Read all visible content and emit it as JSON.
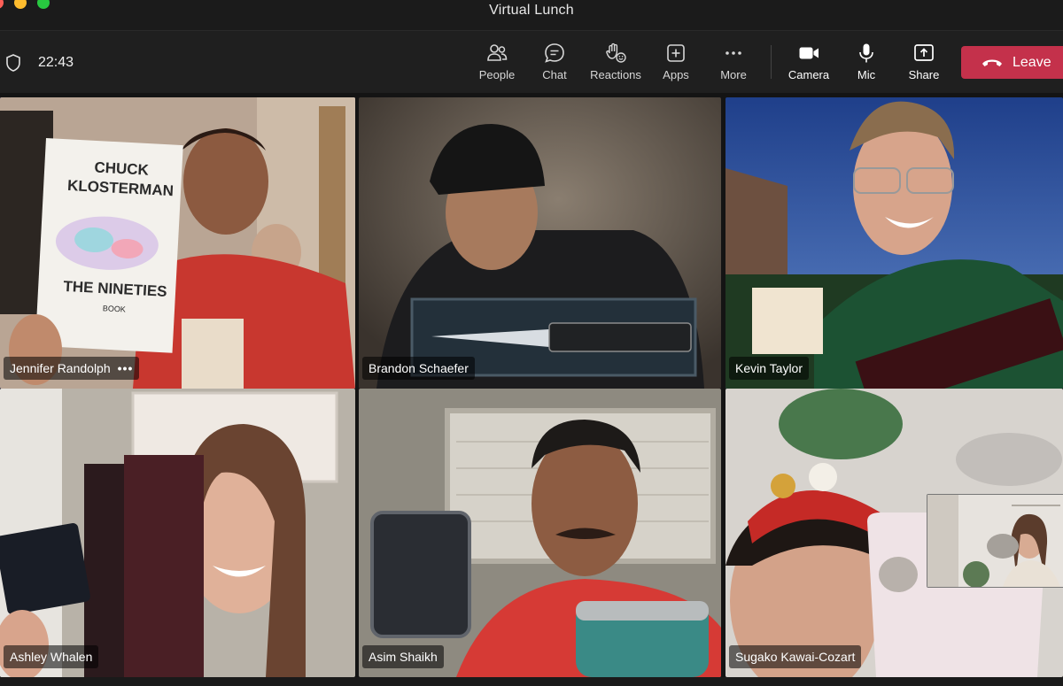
{
  "window": {
    "title": "Virtual Lunch"
  },
  "toolbar": {
    "timer": "22:43",
    "buttons": {
      "people": "People",
      "chat": "Chat",
      "reactions": "Reactions",
      "apps": "Apps",
      "more": "More",
      "camera": "Camera",
      "mic": "Mic",
      "share": "Share"
    },
    "leave": "Leave"
  },
  "participants": [
    {
      "name": "Jennifer Randolph",
      "more": "•••",
      "active": true
    },
    {
      "name": "Brandon Schaefer"
    },
    {
      "name": "Kevin Taylor"
    },
    {
      "name": "Ashley Whalen"
    },
    {
      "name": "Asim Shaikh"
    },
    {
      "name": "Sugako Kawai-Cozart"
    }
  ],
  "book": {
    "line1": "CHUCK",
    "line2": "KLOSTERMAN",
    "line3": "THE NINETIES",
    "line4": "BOOK"
  },
  "colors": {
    "accent": "#7f85f5",
    "leave": "#c4314b"
  }
}
